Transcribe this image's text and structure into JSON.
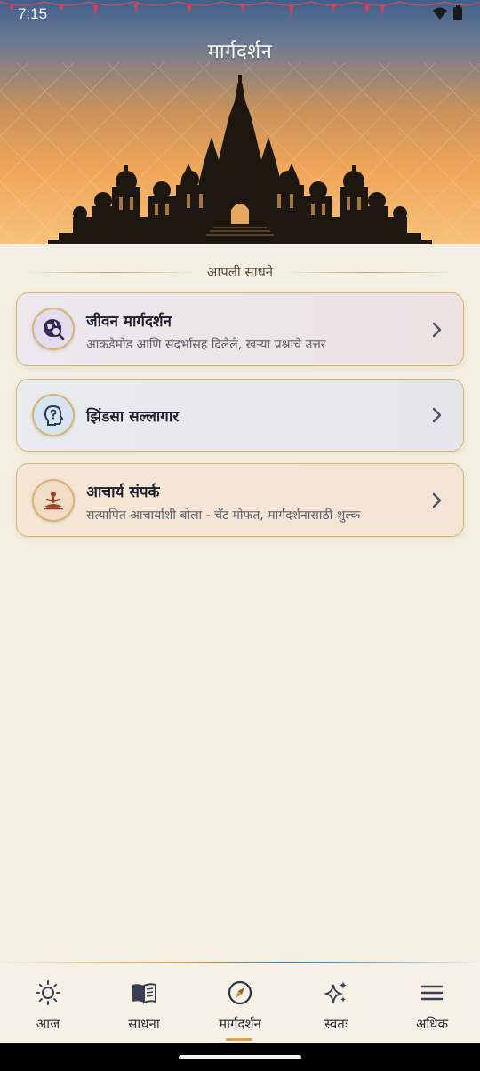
{
  "status_bar": {
    "time": "7:15"
  },
  "header": {
    "title": "मार्गदर्शन"
  },
  "section": {
    "heading": "आपली साधने"
  },
  "cards": [
    {
      "title": "जीवन मार्गदर्शन",
      "subtitle": "आकडेमोड आणि संदर्भासह दिलेले, खऱ्या प्रश्नाचे उत्तर",
      "icon": "globe-search-icon"
    },
    {
      "title": "झिंडसा सल्लागार",
      "subtitle": "",
      "icon": "head-question-icon"
    },
    {
      "title": "आचार्य संपर्क",
      "subtitle": "सत्यापित आचार्यांशी बोला - चॅट मोफत, मार्गदर्शनासाठी शुल्क",
      "icon": "meditation-icon"
    }
  ],
  "nav": {
    "items": [
      {
        "label": "आज",
        "icon": "sun-icon"
      },
      {
        "label": "साधना",
        "icon": "book-icon"
      },
      {
        "label": "मार्गदर्शन",
        "icon": "compass-icon",
        "active": true
      },
      {
        "label": "स्वतः",
        "icon": "sparkles-icon"
      },
      {
        "label": "अधिक",
        "icon": "menu-icon"
      }
    ]
  },
  "colors": {
    "accent_gold": "#d9b56d",
    "background": "#f4efe3",
    "active_icon": "#b8552c"
  }
}
